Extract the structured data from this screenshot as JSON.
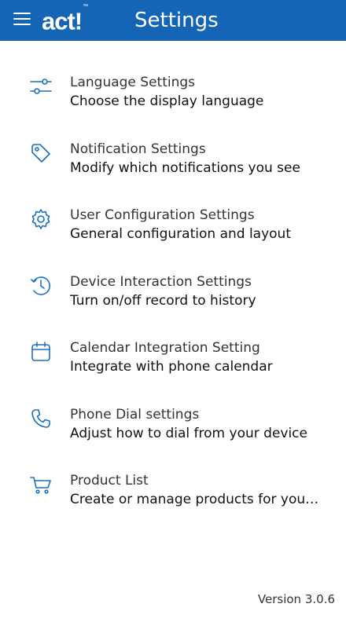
{
  "app": {
    "logo_text": "act!",
    "logo_mark": "™",
    "title": "Settings"
  },
  "settings": [
    {
      "icon": "sliders-icon",
      "title": "Language Settings",
      "subtitle": "Choose the display language"
    },
    {
      "icon": "tag-icon",
      "title": "Notification Settings",
      "subtitle": "Modify which notifications you see"
    },
    {
      "icon": "gear-icon",
      "title": "User Configuration Settings",
      "subtitle": "General configuration and layout"
    },
    {
      "icon": "history-icon",
      "title": "Device Interaction Settings",
      "subtitle": "Turn on/off record to history"
    },
    {
      "icon": "calendar-icon",
      "title": "Calendar Integration Setting",
      "subtitle": "Integrate with phone calendar"
    },
    {
      "icon": "phone-icon",
      "title": "Phone Dial settings",
      "subtitle": "Adjust how to dial from your device"
    },
    {
      "icon": "cart-icon",
      "title": "Product List",
      "subtitle": "Create or manage products for your opportunities"
    }
  ],
  "footer": {
    "version": "Version 3.0.6"
  },
  "colors": {
    "appbar": "#1565b7",
    "icon": "#1a6fc4"
  }
}
